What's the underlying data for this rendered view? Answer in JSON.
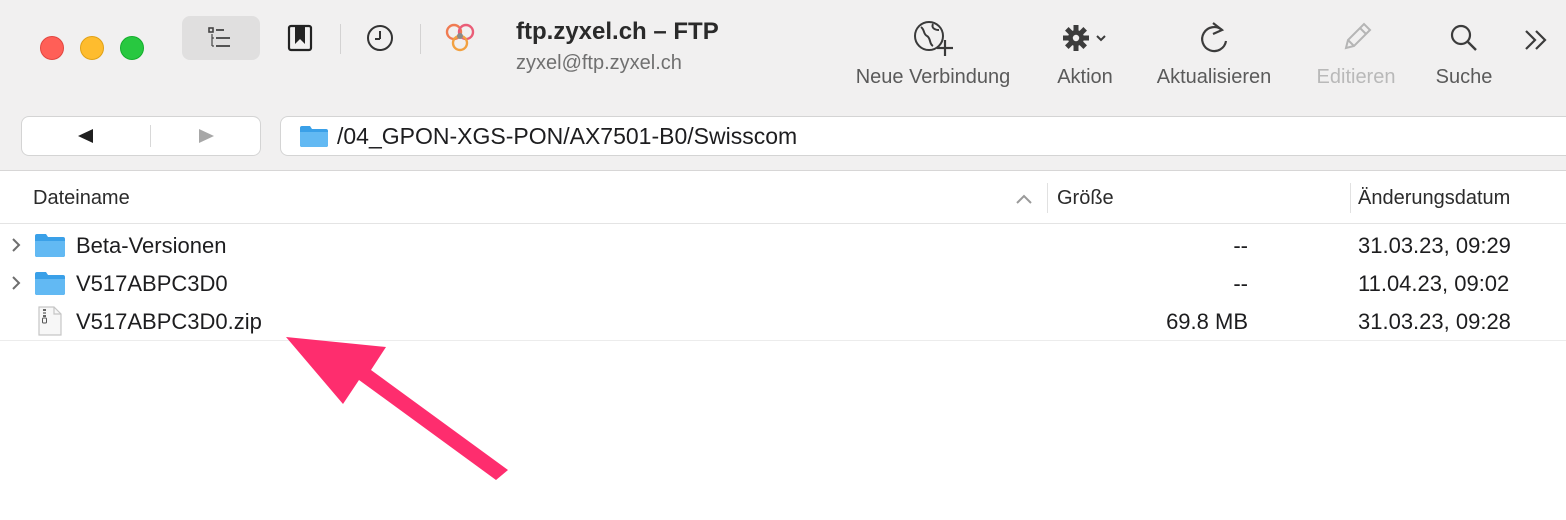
{
  "window": {
    "title": "ftp.zyxel.ch – FTP",
    "subtitle": "zyxel@ftp.zyxel.ch"
  },
  "toolbar": {
    "view_button_icon": "list-view-icon",
    "bookmarks_icon": "bookmark-icon",
    "history_icon": "clock-icon",
    "bonjour_icon": "bonjour-icon",
    "tools": [
      {
        "label": "Neue Verbindung",
        "icon": "globe-plus-icon",
        "enabled": true
      },
      {
        "label": "Aktion",
        "icon": "gear-dropdown-icon",
        "enabled": true
      },
      {
        "label": "Aktualisieren",
        "icon": "refresh-icon",
        "enabled": true
      },
      {
        "label": "Editieren",
        "icon": "pencil-icon",
        "enabled": false
      },
      {
        "label": "Suche",
        "icon": "search-icon",
        "enabled": true
      }
    ],
    "overflow_icon": "chevron-double-right-icon"
  },
  "navigation": {
    "back_icon": "back-arrow-icon",
    "forward_icon": "forward-arrow-icon",
    "path": "/04_GPON-XGS-PON/AX7501-B0/Swisscom"
  },
  "file_list": {
    "columns": {
      "name": "Dateiname",
      "size": "Größe",
      "date": "Änderungsdatum"
    },
    "sort": {
      "column": "name",
      "direction": "ascending"
    },
    "rows": [
      {
        "name": "Beta-Versionen",
        "size": "--",
        "date": "31.03.23, 09:29",
        "kind": "folder"
      },
      {
        "name": "V517ABPC3D0",
        "size": "--",
        "date": "11.04.23, 09:02",
        "kind": "folder"
      },
      {
        "name": "V517ABPC3D0.zip",
        "size": "69.8 MB",
        "date": "31.03.23, 09:28",
        "kind": "zip"
      }
    ]
  },
  "annotation": {
    "color": "#fe2d6e",
    "icon": "pointer-arrow"
  },
  "colors": {
    "folder_blue": "#56b2ef",
    "toolbar_bg": "#f1f0f0"
  }
}
